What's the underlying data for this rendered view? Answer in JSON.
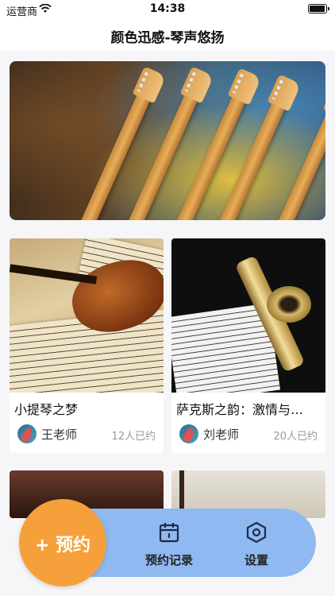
{
  "status_bar": {
    "carrier": "运营商",
    "time": "14:38"
  },
  "nav": {
    "title": "颜色迅感-琴声悠扬"
  },
  "cards": [
    {
      "title": "小提琴之梦",
      "teacher": "王老师",
      "booked": "12人已约",
      "image": "violin-image"
    },
    {
      "title": "萨克斯之韵：激情与…",
      "teacher": "刘老师",
      "booked": "20人已约",
      "image": "saxophone-image"
    }
  ],
  "bottom_nav": {
    "reserve_label": "+ 预约",
    "records_label": "预约记录",
    "settings_label": "设置",
    "icons": {
      "records": "calendar-icon",
      "settings": "settings-hexagon-icon"
    },
    "colors": {
      "reserve": "#f6a03c",
      "bar": "#8fb9f0"
    }
  }
}
